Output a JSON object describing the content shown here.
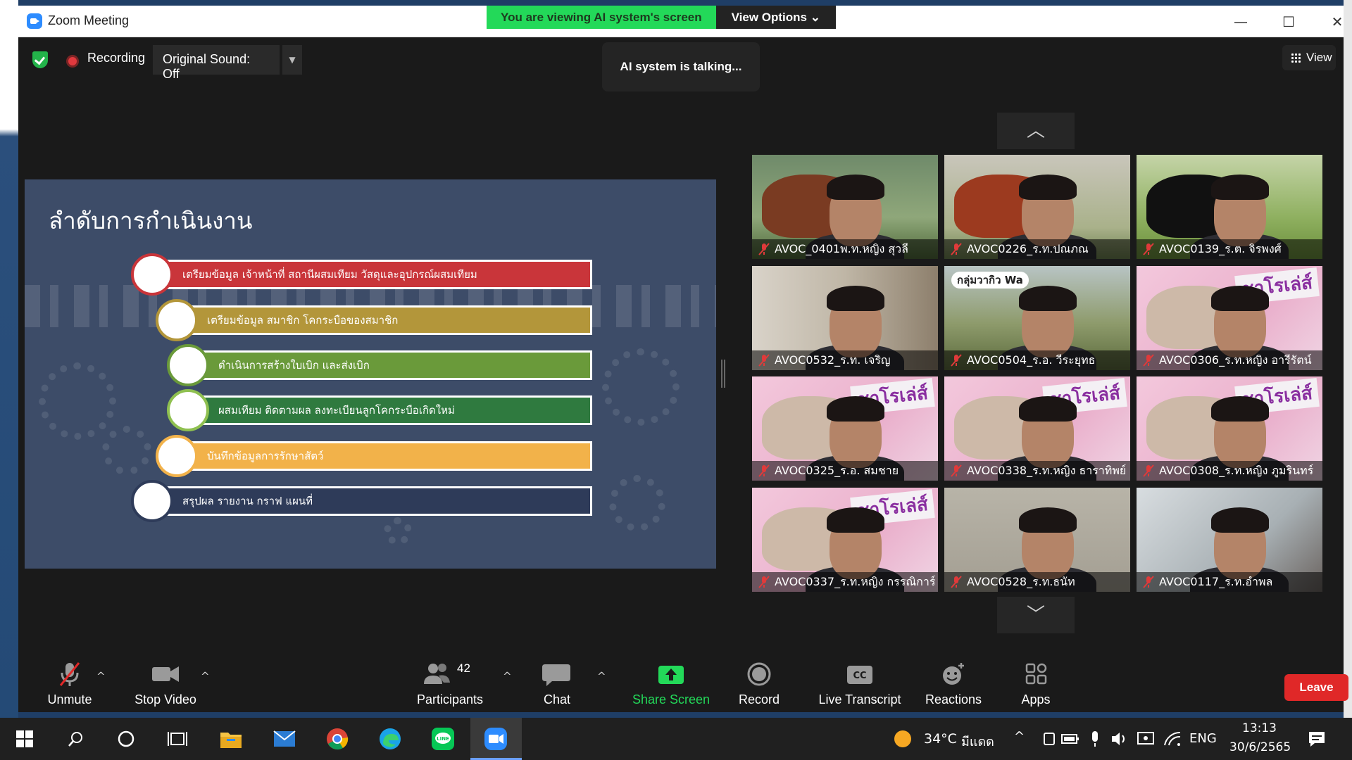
{
  "window": {
    "title": "Zoom Meeting",
    "share_banner": "You are viewing AI system's screen",
    "view_options": "View Options",
    "minimize": "—",
    "maximize": "☐",
    "close": "✕"
  },
  "top_bar": {
    "recording_label": "Recording",
    "original_sound": "Original Sound: Off",
    "talking_status": "AI system is talking...",
    "view_label": "View"
  },
  "slide": {
    "title": "ลำดับการกำเนินงาน",
    "steps": [
      {
        "text": "เตรียมข้อมูล เจ้าหน้าที่ สถานีผสมเทียม วัสดุและอุปกรณ์ผสมเทียม",
        "color": "#c9353a",
        "ring": "#c9353a"
      },
      {
        "text": "เตรียมข้อมูล สมาชิก โคกระบือของสมาชิก",
        "color": "#b3963a",
        "ring": "#b3963a"
      },
      {
        "text": "ดำเนินการสร้างใบเบิก และส่งเบิก",
        "color": "#6a9a3a",
        "ring": "#6a9a3a"
      },
      {
        "text": "ผสมเทียม ติดตามผล ลงทะเบียนลูกโคกระบือเกิดใหม่",
        "color": "#2f7a3f",
        "ring": "#8fc050"
      },
      {
        "text": "บันทึกข้อมูลการรักษาสัตว์",
        "color": "#f2b24a",
        "ring": "#f2b24a"
      },
      {
        "text": "สรุปผล รายงาน กราฟ แผนที่",
        "color": "#2e3b59",
        "ring": "#2e3b59"
      }
    ]
  },
  "participants_grid": [
    {
      "name": "AVOC_0401พ.ท.หญิง สุวลี",
      "scene": "cow-brown"
    },
    {
      "name": "AVOC0226_ร.ท.ปณภณ",
      "scene": "cow-red"
    },
    {
      "name": "AVOC0139_ร.ต. จิรพงศ์",
      "scene": "cow-black"
    },
    {
      "name": "AVOC0532_ร.ท. เจริญ",
      "scene": "indoor"
    },
    {
      "name": "AVOC0504_ร.อ. วีระยุทธ",
      "scene": "field"
    },
    {
      "name": "AVOC0306_ร.ท.หญิง อารีรัตน์",
      "scene": "charolais"
    },
    {
      "name": "AVOC0325_ร.อ. สมชาย",
      "scene": "charolais"
    },
    {
      "name": "AVOC0338_ร.ท.หญิง ธาราทิพย์",
      "scene": "charolais"
    },
    {
      "name": "AVOC0308_ร.ท.หญิง ภูมรินทร์",
      "scene": "charolais"
    },
    {
      "name": "AVOC0337_ร.ท.หญิง กรรณิการ์",
      "scene": "charolais"
    },
    {
      "name": "AVOC0528_ร.ท.ธนัท",
      "scene": "room"
    },
    {
      "name": "AVOC0117_ร.ท.อำพล",
      "scene": "dark"
    }
  ],
  "tile_brand": "ชาโรเล่ส์",
  "tile_sign": "กลุ่มวากิว Wa",
  "controls": {
    "unmute": "Unmute",
    "stop_video": "Stop Video",
    "participants": "Participants",
    "participants_count": "42",
    "chat": "Chat",
    "share_screen": "Share Screen",
    "record": "Record",
    "live_transcript": "Live Transcript",
    "reactions": "Reactions",
    "apps": "Apps",
    "leave": "Leave"
  },
  "taskbar": {
    "temperature": "34°C",
    "weather_text": "มีแดด",
    "language": "ENG",
    "time": "13:13",
    "date": "30/6/2565"
  },
  "colors": {
    "share_green": "#23d959",
    "leave_red": "#e02828",
    "share_screen_green": "#23d959"
  }
}
